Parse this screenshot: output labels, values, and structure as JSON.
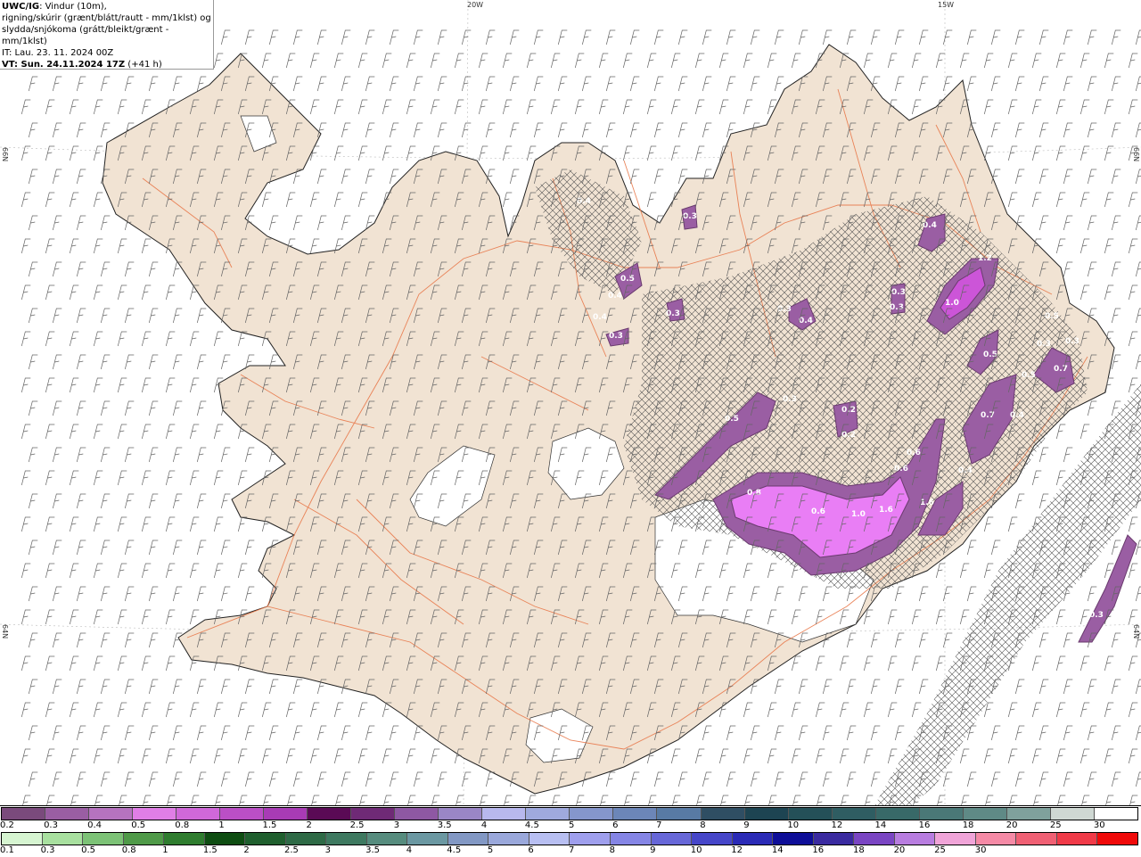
{
  "header": {
    "model": "UWC/IG",
    "line1_rest": ": Vindur (10m),",
    "line2": "rigning/skúrir (grænt/blátt/rautt - mm/1klst) og",
    "line3": "slydda/snjókoma (grátt/bleikt/grænt - mm/1klst)",
    "issue_time": "IT: Lau. 23. 11. 2024 00Z",
    "valid_prefix": "VT: Sun. 24.11.2024 17Z",
    "valid_suffix": " (+41 h)"
  },
  "grid_labels": {
    "top_20w": "20W",
    "top_15w": "15W",
    "left_66n": "66N",
    "left_64n": "64N",
    "right_66n": "66N",
    "right_64n": "64N"
  },
  "colors": {
    "land": "#f1e3d3",
    "roads": "#e8784a",
    "snow_light": "#c68fd0",
    "snow_mid": "#cc55d8",
    "snow_strong": "#e97ef5",
    "snow_edge": "#6a3b6e",
    "ice": "#ffffff"
  },
  "legend": {
    "snow_row_colors": [
      "#7a4a7c",
      "#9a5ea3",
      "#b673bf",
      "#e07ee6",
      "#d068d9",
      "#bb4fc6",
      "#a83bb5",
      "#5a0a55",
      "#6f2a76",
      "#8e58a3",
      "#9a86c6",
      "#b8b8ee",
      "#9fa9dd",
      "#8596cc",
      "#6c86b8",
      "#587aa4",
      "#2f4e63",
      "#1d4452",
      "#245058",
      "#2f5d62",
      "#386968",
      "#4a7877",
      "#5f8a86",
      "#7fa19c",
      "#cfd8d3",
      "#ffffff"
    ],
    "snow_row_labels": [
      "0.2",
      "0.3",
      "0.4",
      "0.5",
      "0.8",
      "1",
      "1.5",
      "2",
      "2.5",
      "3",
      "3.5",
      "4",
      "4.5",
      "5",
      "6",
      "7",
      "8",
      "9",
      "10",
      "12",
      "14",
      "16",
      "18",
      "20",
      "25",
      "30"
    ],
    "rain_row_colors": [
      "#d6f5d1",
      "#a8e09f",
      "#7cc276",
      "#4f9a48",
      "#2f7d2f",
      "#0e4d12",
      "#1f5f2e",
      "#2e6a46",
      "#3e7960",
      "#568c7e",
      "#6b98a2",
      "#8298c4",
      "#9aa8db",
      "#b8bff2",
      "#9f9fed",
      "#8585e5",
      "#6767d8",
      "#4646c9",
      "#2a2ab6",
      "#0e0e98",
      "#3a2aa0",
      "#7a45c3",
      "#b87de0",
      "#f0a4d8",
      "#f58aa6",
      "#f06074",
      "#f03a48",
      "#f00a0a"
    ],
    "rain_row_labels": [
      "0.1",
      "0.3",
      "0.5",
      "0.8",
      "1",
      "1.5",
      "2",
      "2.5",
      "3",
      "3.5",
      "4",
      "4.5",
      "5",
      "6",
      "7",
      "8",
      "9",
      "10",
      "12",
      "14",
      "16",
      "18",
      "20",
      "25",
      "30"
    ]
  },
  "precip_labels": [
    {
      "v": "0.4"
    },
    {
      "v": "0.3"
    },
    {
      "v": "0.4"
    },
    {
      "v": "1.2"
    },
    {
      "v": "0.5"
    },
    {
      "v": "0.4"
    },
    {
      "v": "0.3"
    },
    {
      "v": "0.3"
    },
    {
      "v": "0.3"
    },
    {
      "v": "0.4"
    },
    {
      "v": "0.3"
    },
    {
      "v": "1.0"
    },
    {
      "v": "0.4"
    },
    {
      "v": "0.3"
    },
    {
      "v": "0.3"
    },
    {
      "v": "0.5"
    },
    {
      "v": "0.5"
    },
    {
      "v": "0.7"
    },
    {
      "v": "0.5"
    },
    {
      "v": "0.2"
    },
    {
      "v": "0.5"
    },
    {
      "v": "0.7"
    },
    {
      "v": "0.4"
    },
    {
      "v": "0.2"
    },
    {
      "v": "0.6"
    },
    {
      "v": "0.6"
    },
    {
      "v": "0.4"
    },
    {
      "v": "0.8"
    },
    {
      "v": "0.6"
    },
    {
      "v": "1.0"
    },
    {
      "v": "1.6"
    },
    {
      "v": "1.6"
    },
    {
      "v": "0.3"
    },
    {
      "v": "0.3"
    },
    {
      "v": "0.3"
    }
  ]
}
